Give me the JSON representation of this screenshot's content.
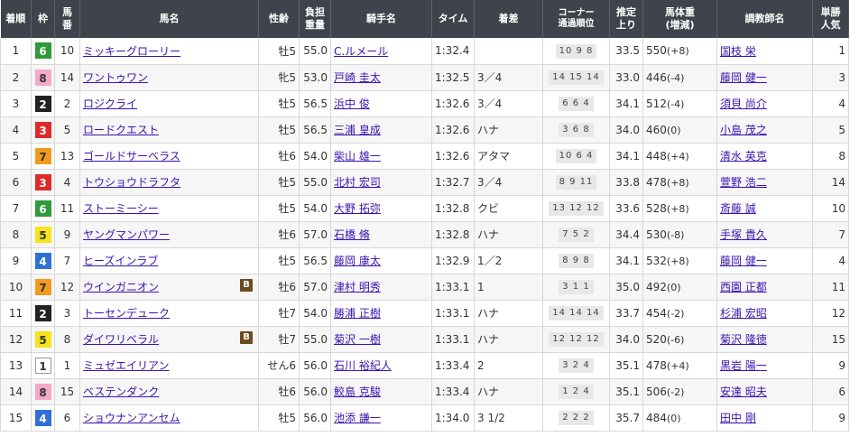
{
  "headers": {
    "rank": "着順",
    "waku": "枠",
    "umaban_1": "馬",
    "umaban_2": "番",
    "horse": "馬名",
    "sexage": "性齢",
    "weight_1": "負担",
    "weight_2": "重量",
    "jockey": "騎手名",
    "time": "タイム",
    "margin": "着差",
    "corner_1": "コーナー",
    "corner_2": "通過順位",
    "last3f_1": "推定",
    "last3f_2": "上り",
    "bodyweight_1": "馬体重",
    "bodyweight_2": "(増減)",
    "trainer": "調教師名",
    "pop_1": "単勝",
    "pop_2": "人気"
  },
  "waku_colors": {
    "1": {
      "bg": "#ffffff",
      "fg": "#333333",
      "border": "#999999"
    },
    "2": {
      "bg": "#222222",
      "fg": "#ffffff",
      "border": "#222222"
    },
    "3": {
      "bg": "#e0292b",
      "fg": "#ffffff",
      "border": "#e0292b"
    },
    "4": {
      "bg": "#2f6fd6",
      "fg": "#ffffff",
      "border": "#2f6fd6"
    },
    "5": {
      "bg": "#f6e31c",
      "fg": "#333333",
      "border": "#f6e31c"
    },
    "6": {
      "bg": "#2f9a3a",
      "fg": "#ffffff",
      "border": "#2f9a3a"
    },
    "7": {
      "bg": "#f39a1e",
      "fg": "#333333",
      "border": "#f39a1e"
    },
    "8": {
      "bg": "#f4a9c8",
      "fg": "#333333",
      "border": "#f4a9c8"
    }
  },
  "blinker_label": "B",
  "rows": [
    {
      "rank": "1",
      "waku": "6",
      "umaban": "10",
      "horse": "ミッキーグローリー",
      "blinker": false,
      "sexage": "牡5",
      "weight": "55.0",
      "jockey": "C.ルメール",
      "time": "1:32.4",
      "margin": "",
      "corner": "10 9 8",
      "last3f": "33.5",
      "bw": "550",
      "bwdiff": "(+8)",
      "trainer": "国枝 栄",
      "pop": "1"
    },
    {
      "rank": "2",
      "waku": "8",
      "umaban": "14",
      "horse": "ワントゥワン",
      "blinker": false,
      "sexage": "牝5",
      "weight": "53.0",
      "jockey": "戸崎 圭太",
      "time": "1:32.5",
      "margin": "3／4",
      "corner": "14 15 14",
      "last3f": "33.0",
      "bw": "446",
      "bwdiff": "(-4)",
      "trainer": "藤岡 健一",
      "pop": "3"
    },
    {
      "rank": "3",
      "waku": "2",
      "umaban": "2",
      "horse": "ロジクライ",
      "blinker": false,
      "sexage": "牡5",
      "weight": "56.5",
      "jockey": "浜中 俊",
      "time": "1:32.6",
      "margin": "3／4",
      "corner": "6 6 4",
      "last3f": "34.1",
      "bw": "512",
      "bwdiff": "(-4)",
      "trainer": "須貝 尚介",
      "pop": "4"
    },
    {
      "rank": "4",
      "waku": "3",
      "umaban": "5",
      "horse": "ロードクエスト",
      "blinker": false,
      "sexage": "牡5",
      "weight": "56.5",
      "jockey": "三浦 皇成",
      "time": "1:32.6",
      "margin": "ハナ",
      "corner": "3 6 8",
      "last3f": "34.0",
      "bw": "460",
      "bwdiff": "(0)",
      "trainer": "小島 茂之",
      "pop": "5"
    },
    {
      "rank": "5",
      "waku": "7",
      "umaban": "13",
      "horse": "ゴールドサーベラス",
      "blinker": false,
      "sexage": "牡6",
      "weight": "54.0",
      "jockey": "柴山 雄一",
      "time": "1:32.6",
      "margin": "アタマ",
      "corner": "10 6 4",
      "last3f": "34.1",
      "bw": "448",
      "bwdiff": "(+4)",
      "trainer": "清水 英克",
      "pop": "8"
    },
    {
      "rank": "6",
      "waku": "3",
      "umaban": "4",
      "horse": "トウショウドラフタ",
      "blinker": false,
      "sexage": "牡5",
      "weight": "55.0",
      "jockey": "北村 宏司",
      "time": "1:32.7",
      "margin": "3／4",
      "corner": "8 9 11",
      "last3f": "33.8",
      "bw": "478",
      "bwdiff": "(+8)",
      "trainer": "萱野 浩二",
      "pop": "14"
    },
    {
      "rank": "7",
      "waku": "6",
      "umaban": "11",
      "horse": "ストーミーシー",
      "blinker": false,
      "sexage": "牡5",
      "weight": "54.0",
      "jockey": "大野 拓弥",
      "time": "1:32.8",
      "margin": "クビ",
      "corner": "13 12 12",
      "last3f": "33.6",
      "bw": "528",
      "bwdiff": "(+8)",
      "trainer": "斎藤 誠",
      "pop": "10"
    },
    {
      "rank": "8",
      "waku": "5",
      "umaban": "9",
      "horse": "ヤングマンパワー",
      "blinker": false,
      "sexage": "牡6",
      "weight": "57.0",
      "jockey": "石橋 脩",
      "time": "1:32.8",
      "margin": "ハナ",
      "corner": "7 5 2",
      "last3f": "34.4",
      "bw": "530",
      "bwdiff": "(-8)",
      "trainer": "手塚 貴久",
      "pop": "7"
    },
    {
      "rank": "9",
      "waku": "4",
      "umaban": "7",
      "horse": "ヒーズインラブ",
      "blinker": false,
      "sexage": "牡5",
      "weight": "56.5",
      "jockey": "藤岡 康太",
      "time": "1:32.9",
      "margin": "1／2",
      "corner": "8 9 8",
      "last3f": "34.1",
      "bw": "532",
      "bwdiff": "(+8)",
      "trainer": "藤岡 健一",
      "pop": "4"
    },
    {
      "rank": "10",
      "waku": "7",
      "umaban": "12",
      "horse": "ウインガニオン",
      "blinker": true,
      "sexage": "牡6",
      "weight": "57.0",
      "jockey": "津村 明秀",
      "time": "1:33.1",
      "margin": "1",
      "corner": "3 1 1",
      "last3f": "35.0",
      "bw": "492",
      "bwdiff": "(0)",
      "trainer": "西園 正都",
      "pop": "11"
    },
    {
      "rank": "11",
      "waku": "2",
      "umaban": "3",
      "horse": "トーセンデューク",
      "blinker": false,
      "sexage": "牡7",
      "weight": "54.0",
      "jockey": "勝浦 正樹",
      "time": "1:33.1",
      "margin": "ハナ",
      "corner": "14 14 14",
      "last3f": "33.7",
      "bw": "454",
      "bwdiff": "(-2)",
      "trainer": "杉浦 宏昭",
      "pop": "12"
    },
    {
      "rank": "12",
      "waku": "5",
      "umaban": "8",
      "horse": "ダイワリベラル",
      "blinker": true,
      "sexage": "牡7",
      "weight": "55.0",
      "jockey": "菊沢 一樹",
      "time": "1:33.1",
      "margin": "ハナ",
      "corner": "12 12 12",
      "last3f": "34.0",
      "bw": "520",
      "bwdiff": "(-6)",
      "trainer": "菊沢 隆徳",
      "pop": "15"
    },
    {
      "rank": "13",
      "waku": "1",
      "umaban": "1",
      "horse": "ミュゼエイリアン",
      "blinker": false,
      "sexage": "せん6",
      "weight": "56.0",
      "jockey": "石川 裕紀人",
      "time": "1:33.4",
      "margin": "2",
      "corner": "3 2 4",
      "last3f": "35.1",
      "bw": "478",
      "bwdiff": "(+4)",
      "trainer": "黒岩 陽一",
      "pop": "9"
    },
    {
      "rank": "14",
      "waku": "8",
      "umaban": "15",
      "horse": "ベステンダンク",
      "blinker": false,
      "sexage": "牡6",
      "weight": "56.0",
      "jockey": "鮫島 克駿",
      "time": "1:33.4",
      "margin": "ハナ",
      "corner": "1 2 4",
      "last3f": "35.1",
      "bw": "506",
      "bwdiff": "(-2)",
      "trainer": "安達 昭夫",
      "pop": "6"
    },
    {
      "rank": "15",
      "waku": "4",
      "umaban": "6",
      "horse": "ショウナンアンセム",
      "blinker": false,
      "sexage": "牡5",
      "weight": "56.0",
      "jockey": "池添 謙一",
      "time": "1:34.0",
      "margin": "3 1/2",
      "corner": "2 2 2",
      "last3f": "35.7",
      "bw": "484",
      "bwdiff": "(0)",
      "trainer": "田中 剛",
      "pop": "9"
    }
  ]
}
